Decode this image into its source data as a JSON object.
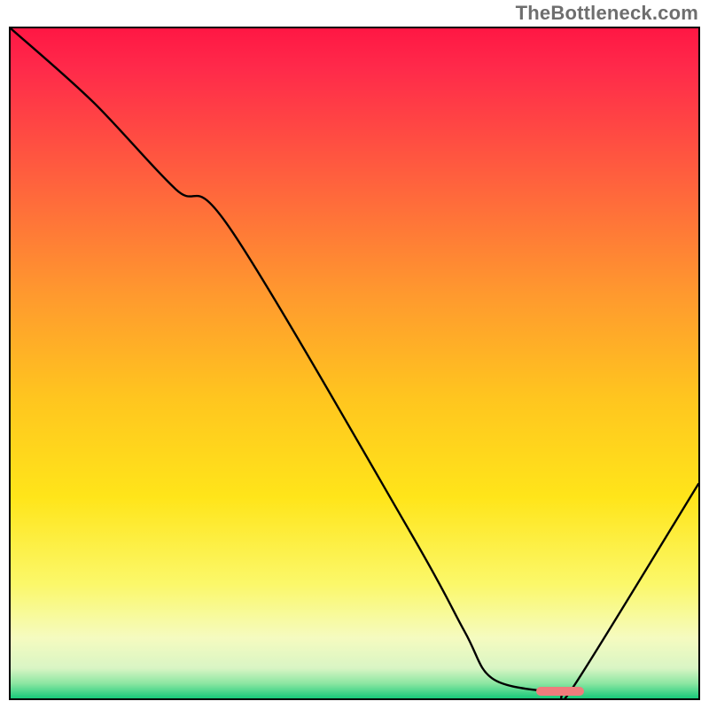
{
  "watermark": "TheBottleneck.com",
  "chart_data": {
    "type": "line",
    "title": "",
    "xlabel": "",
    "ylabel": "",
    "xlim": [
      0,
      100
    ],
    "ylim": [
      0,
      100
    ],
    "grid": false,
    "legend": false,
    "x": [
      0,
      12,
      24,
      32,
      58,
      66,
      70,
      78,
      80,
      82,
      100
    ],
    "values": [
      100,
      89,
      76,
      70,
      25,
      10,
      3,
      1,
      1,
      2,
      32
    ],
    "marker": {
      "x_start": 76,
      "x_end": 83,
      "y": 0.5
    },
    "gradient_stops": [
      {
        "offset": 0.0,
        "color": "#ff1744"
      },
      {
        "offset": 0.06,
        "color": "#ff2a4a"
      },
      {
        "offset": 0.22,
        "color": "#ff5f3e"
      },
      {
        "offset": 0.4,
        "color": "#ff9a2e"
      },
      {
        "offset": 0.55,
        "color": "#ffc51f"
      },
      {
        "offset": 0.7,
        "color": "#ffe51a"
      },
      {
        "offset": 0.83,
        "color": "#fbf86a"
      },
      {
        "offset": 0.91,
        "color": "#f5fbc0"
      },
      {
        "offset": 0.955,
        "color": "#d9f5c4"
      },
      {
        "offset": 0.978,
        "color": "#8be6a1"
      },
      {
        "offset": 1.0,
        "color": "#17c97a"
      }
    ]
  }
}
